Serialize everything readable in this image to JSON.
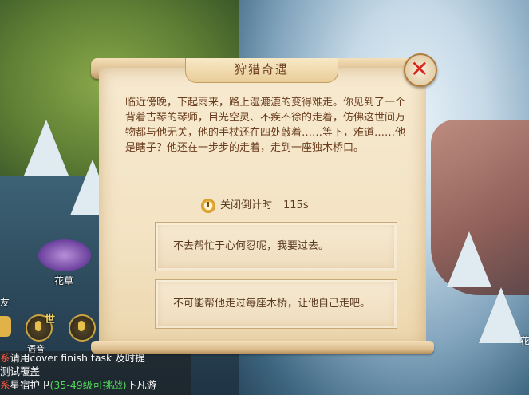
{
  "dialog": {
    "title": "狩猎奇遇",
    "close_icon": "close-x-icon",
    "story": "临近傍晚，下起雨来，路上湿漉漉的变得难走。你见到了一个背着古琴的琴师，目光空灵、不疾不徐的走着，仿佛这世间万物都与他无关，他的手杖还在四处敲着……等下，难道……他是瞎子？他还在一步步的走着，走到一座独木桥口。",
    "timer_label": "关闭倒计时",
    "timer_value": "115s",
    "options": [
      "不去帮忙于心何忍呢，我要过去。",
      "不可能帮他走过每座木桥，让他自己走吧。"
    ]
  },
  "world": {
    "flower_label": "花草",
    "side_label": "友",
    "world_tag": "世",
    "mic_label": "语音",
    "right_label": "花"
  },
  "chat": {
    "line1_tag": "系",
    "line1_text": "请用cover finish task 及时提",
    "line2_text": "测试覆盖",
    "line3_tag": "系",
    "line3_text_a": "星宿护卫",
    "line3_text_green": "(35-49级可挑战)",
    "line3_text_b": "下凡游"
  }
}
